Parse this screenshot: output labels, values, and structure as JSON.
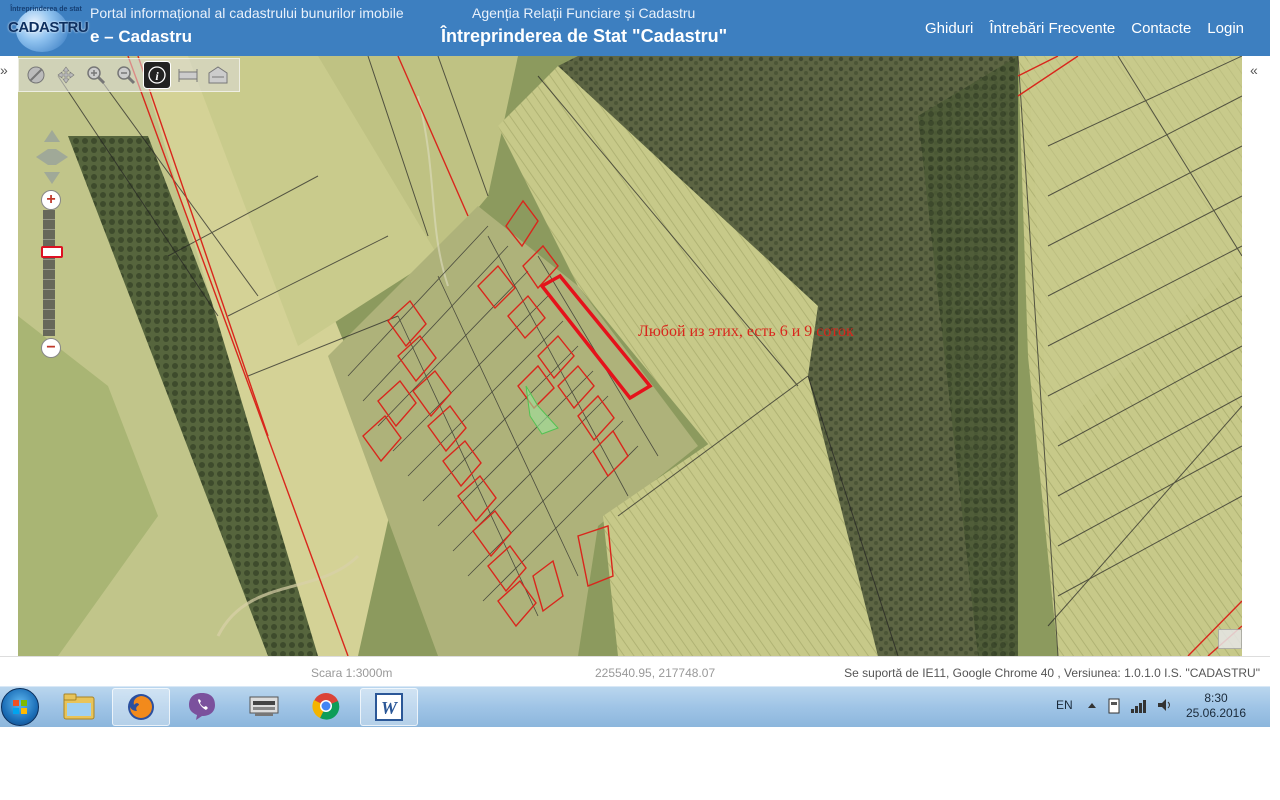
{
  "header": {
    "logo_top": "Întreprinderea de stat",
    "logo_main": "CADASTRU",
    "portal_text": "Portal informațional al cadastrului bunurilor imobile",
    "site_name": "e – Cadastru",
    "agency": "Agenția Relații Funciare și Cadastru",
    "enterprise": "Întreprinderea de Stat \"Cadastru\"",
    "nav": [
      "Ghiduri",
      "Întrebări Frecvente",
      "Contacte",
      "Login"
    ]
  },
  "map": {
    "left_collapse": "»",
    "right_collapse": "«",
    "annotation": "Любой из этих, есть 6 и 9 соток",
    "toolbar_icons": [
      "select-icon",
      "pan-icon",
      "zoom-in-icon",
      "zoom-out-icon",
      "info-icon",
      "measure-distance-icon",
      "measure-area-icon"
    ],
    "zoom": {
      "plus": "+",
      "minus": "−"
    },
    "annotation_color": "#d9261c"
  },
  "statusbar": {
    "scale": "Scara 1:3000m",
    "coordinates": "225540.95, 217748.07",
    "support": "Se suportă de IE11, Google Chrome 40 , Versiunea: 1.0.1.0 I.S. \"CADASTRU\""
  },
  "taskbar": {
    "apps": [
      "file-explorer-icon",
      "firefox-icon",
      "viber-icon",
      "network-app-icon",
      "chrome-icon",
      "word-icon"
    ],
    "language": "EN",
    "time": "8:30",
    "date": "25.06.2016"
  }
}
